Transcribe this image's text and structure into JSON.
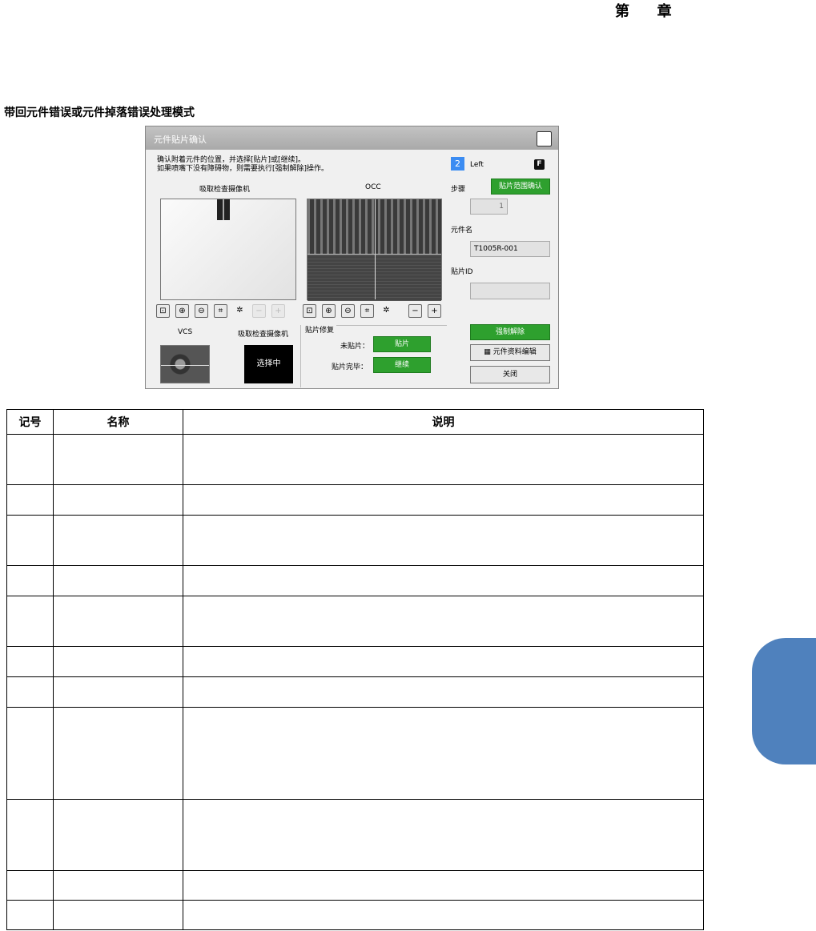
{
  "header": {
    "chapter_label_1": "第",
    "chapter_label_2": "章"
  },
  "section_title": "带回元件错误或元件掉落错误处理模式",
  "dialog": {
    "title": "元件贴片确认",
    "close_label": "×",
    "message_line1": "确认附着元件的位置，并选择[贴片]或[继续]。",
    "message_line2": "如果喷嘴下没有障碍物，则需要执行[强制解除]操作。",
    "camera1_label": "吸取检查摄像机",
    "camera2_label": "OCC",
    "vcs_label": "VCS",
    "camera1_label_lower": "吸取检查摄像机",
    "selecting_label": "选择中",
    "repair_group_label": "贴片修复",
    "not_placed_label": "未贴片：",
    "place_button": "贴片",
    "placed_label": "贴片完毕：",
    "continue_button": "继续",
    "head_number": "2",
    "head_side": "Left",
    "f_badge": "F",
    "step_label": "步骤",
    "range_confirm_button": "贴片范围确认",
    "step_value": "1",
    "part_name_label": "元件名",
    "part_name_value": "T1005R-001",
    "placement_id_label": "贴片ID",
    "placement_id_value": "",
    "force_release_button": "强制解除",
    "part_data_edit_button": "元件资料编辑",
    "close_button": "关闭",
    "toolbar_icons": [
      "fit-icon",
      "zoom-in-icon",
      "zoom-out-icon",
      "expand-icon",
      "light-icon",
      "minus-icon",
      "plus-icon"
    ],
    "colors": {
      "green": "#2ea02e",
      "blue_badge": "#3b8cf2",
      "titlebar": "#b4b4b4"
    }
  },
  "table": {
    "headers": [
      "记号",
      "名称",
      "说明"
    ],
    "rows": [
      {
        "mark": "",
        "name": "",
        "desc": ""
      },
      {
        "mark": "",
        "name": "",
        "desc": ""
      },
      {
        "mark": "",
        "name": "",
        "desc": ""
      },
      {
        "mark": "",
        "name": "",
        "desc": ""
      },
      {
        "mark": "",
        "name": "",
        "desc": ""
      },
      {
        "mark": "",
        "name": "",
        "desc": ""
      },
      {
        "mark": "",
        "name": "",
        "desc": ""
      },
      {
        "mark": "",
        "name": "",
        "desc": ""
      },
      {
        "mark": "",
        "name": "",
        "desc": ""
      },
      {
        "mark": "",
        "name": "",
        "desc": ""
      },
      {
        "mark": "",
        "name": "",
        "desc": ""
      }
    ]
  },
  "side_tab_color": "#4f81bd"
}
